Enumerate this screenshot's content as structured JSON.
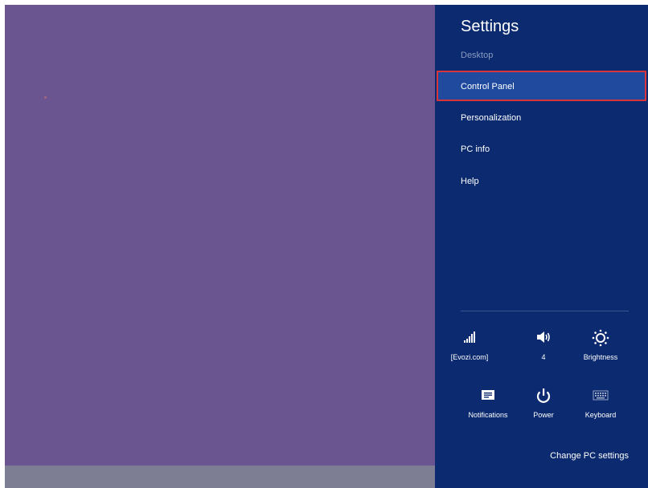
{
  "settings": {
    "title": "Settings",
    "subtitle": "Desktop",
    "items": [
      {
        "label": "Control Panel",
        "selected": true
      },
      {
        "label": "Personalization",
        "selected": false
      },
      {
        "label": "PC info",
        "selected": false
      },
      {
        "label": "Help",
        "selected": false
      }
    ],
    "quick": {
      "network": {
        "label": "[Evozi.com]",
        "icon": "wifi-signal-icon"
      },
      "volume": {
        "label": "4",
        "icon": "speaker-icon"
      },
      "brightness": {
        "label": "Brightness",
        "icon": "sun-icon"
      },
      "notifications": {
        "label": "Notifications",
        "icon": "message-icon"
      },
      "power": {
        "label": "Power",
        "icon": "power-icon"
      },
      "keyboard": {
        "label": "Keyboard",
        "icon": "keyboard-icon"
      }
    },
    "change_pc_settings": "Change PC settings"
  },
  "colors": {
    "desktop": "#6b5590",
    "pane": "#0b2a6f",
    "selected_item": "#1f4a9e",
    "selection_border": "#d9353b",
    "taskbar": "#7d7d94"
  }
}
